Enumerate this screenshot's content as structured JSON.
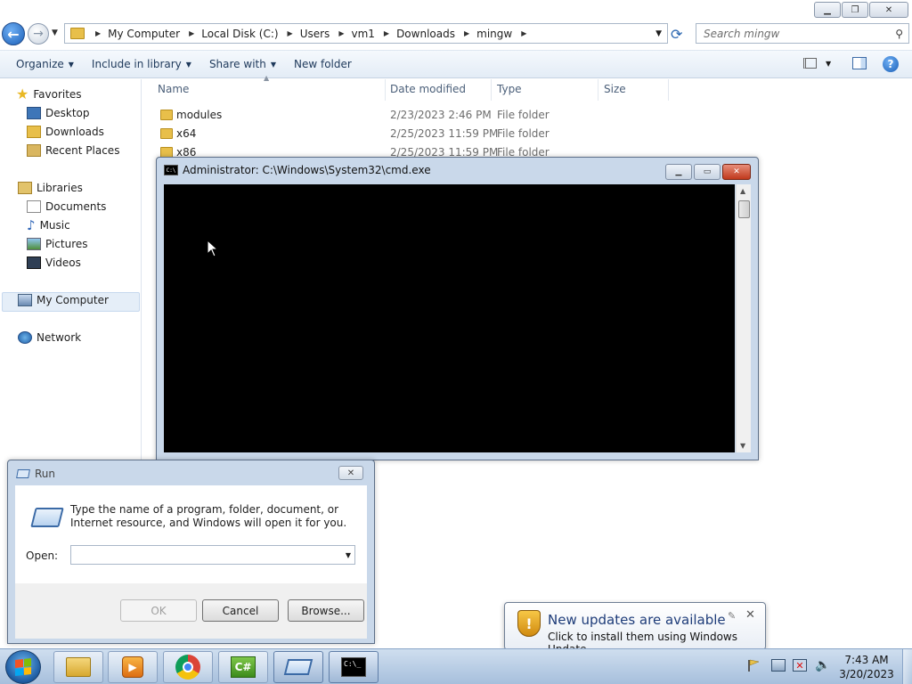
{
  "explorer": {
    "breadcrumbs": [
      "My Computer",
      "Local Disk (C:)",
      "Users",
      "vm1",
      "Downloads",
      "mingw"
    ],
    "search_placeholder": "Search mingw",
    "toolbar": {
      "organize": "Organize",
      "include_in_library": "Include in library",
      "share_with": "Share with",
      "new_folder": "New folder"
    },
    "nav": {
      "favorites": "Favorites",
      "desktop": "Desktop",
      "downloads": "Downloads",
      "recent_places": "Recent Places",
      "libraries": "Libraries",
      "documents": "Documents",
      "music": "Music",
      "pictures": "Pictures",
      "videos": "Videos",
      "my_computer": "My Computer",
      "network": "Network"
    },
    "columns": {
      "name": "Name",
      "date_modified": "Date modified",
      "type": "Type",
      "size": "Size"
    },
    "files": [
      {
        "name": "modules",
        "date": "2/23/2023 2:46 PM",
        "type": "File folder"
      },
      {
        "name": "x64",
        "date": "2/25/2023 11:59 PM",
        "type": "File folder"
      },
      {
        "name": "x86",
        "date": "2/25/2023 11:59 PM",
        "type": "File folder"
      }
    ]
  },
  "cmd": {
    "title": "Administrator: C:\\Windows\\System32\\cmd.exe",
    "icon_text": "C:\\"
  },
  "run": {
    "title": "Run",
    "description": "Type the name of a program, folder, document, or Internet resource, and Windows will open it for you.",
    "open_label": "Open:",
    "open_value": "",
    "ok": "OK",
    "cancel": "Cancel",
    "browse": "Browse..."
  },
  "balloon": {
    "title": "New updates are available",
    "text": "Click to install them using Windows Update."
  },
  "taskbar": {
    "cs_icon_text": "C#",
    "cmd_icon_text": "C:\\_",
    "clock_time": "7:43 AM",
    "clock_date": "3/20/2023"
  }
}
